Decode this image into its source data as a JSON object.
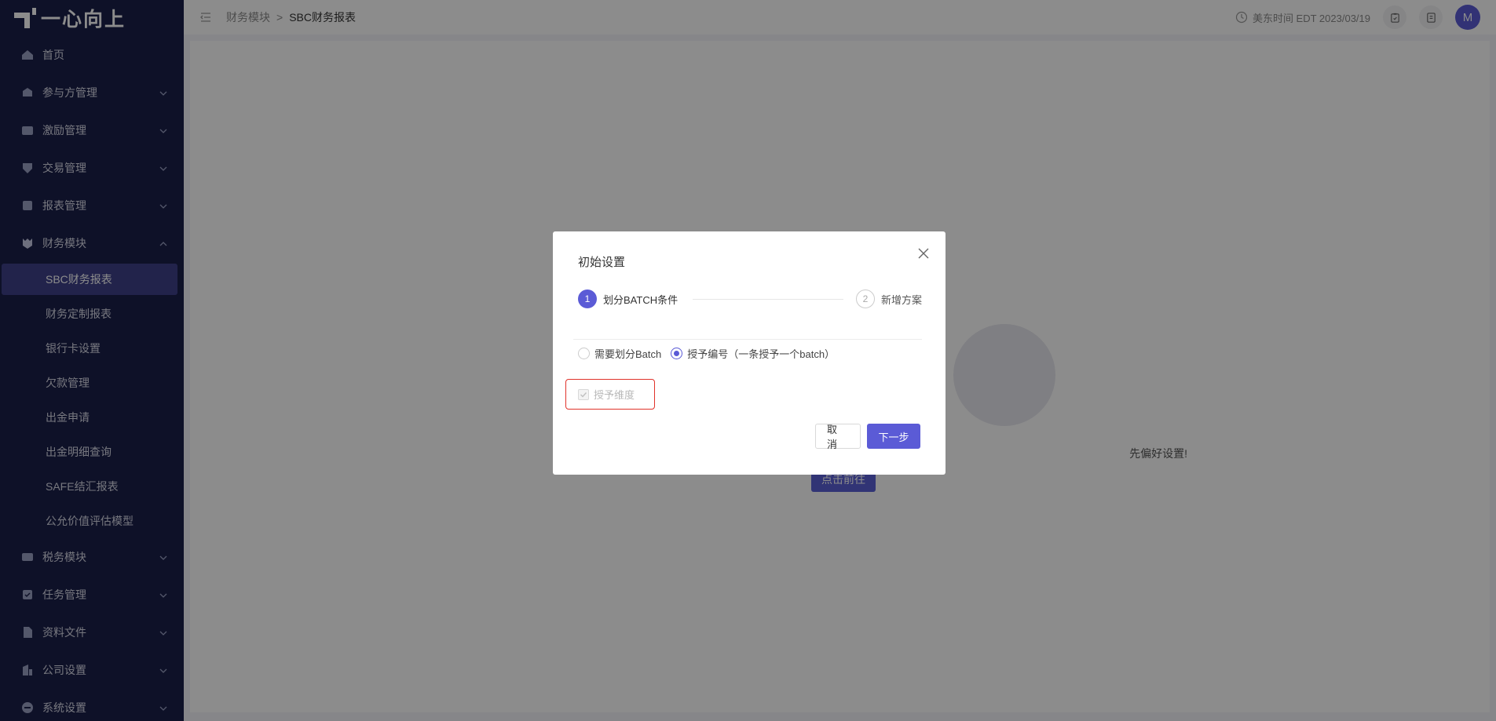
{
  "app": {
    "logo_text": "一心向上"
  },
  "sidebar": {
    "items": [
      {
        "label": "首页",
        "icon": "home-icon"
      },
      {
        "label": "参与方管理",
        "icon": "participant-icon"
      },
      {
        "label": "激励管理",
        "icon": "incentive-icon"
      },
      {
        "label": "交易管理",
        "icon": "transaction-icon"
      },
      {
        "label": "报表管理",
        "icon": "report-icon"
      },
      {
        "label": "财务模块",
        "icon": "finance-icon"
      },
      {
        "label": "税务模块",
        "icon": "tax-icon"
      },
      {
        "label": "任务管理",
        "icon": "task-icon"
      },
      {
        "label": "资料文件",
        "icon": "file-icon"
      },
      {
        "label": "公司设置",
        "icon": "company-icon"
      },
      {
        "label": "系统设置",
        "icon": "system-icon"
      }
    ],
    "finance_sub": [
      "SBC财务报表",
      "财务定制报表",
      "银行卡设置",
      "欠款管理",
      "出金申请",
      "出金明细查询",
      "SAFE结汇报表",
      "公允价值评估模型"
    ]
  },
  "header": {
    "breadcrumb": [
      "财务模块",
      "SBC财务报表"
    ],
    "separator": ">",
    "time": "美东时间 EDT 2023/03/19",
    "avatar_initial": "M"
  },
  "main": {
    "empty_text": "先偏好设置!",
    "goto_label": "点击前往"
  },
  "modal": {
    "title": "初始设置",
    "steps": [
      {
        "num": "1",
        "label": "划分BATCH条件"
      },
      {
        "num": "2",
        "label": "新增方案"
      }
    ],
    "radio_options": [
      "需要划分Batch",
      "授予编号（一条授予一个batch）"
    ],
    "selected_radio": "授予编号（一条授予一个batch）",
    "checkbox_label": "授予维度",
    "cancel_label": "取 消",
    "next_label": "下一步"
  },
  "colors": {
    "accent": "#5b5bd6",
    "sidebar_bg": "#1b1f4a",
    "highlight": "#e0322a"
  }
}
